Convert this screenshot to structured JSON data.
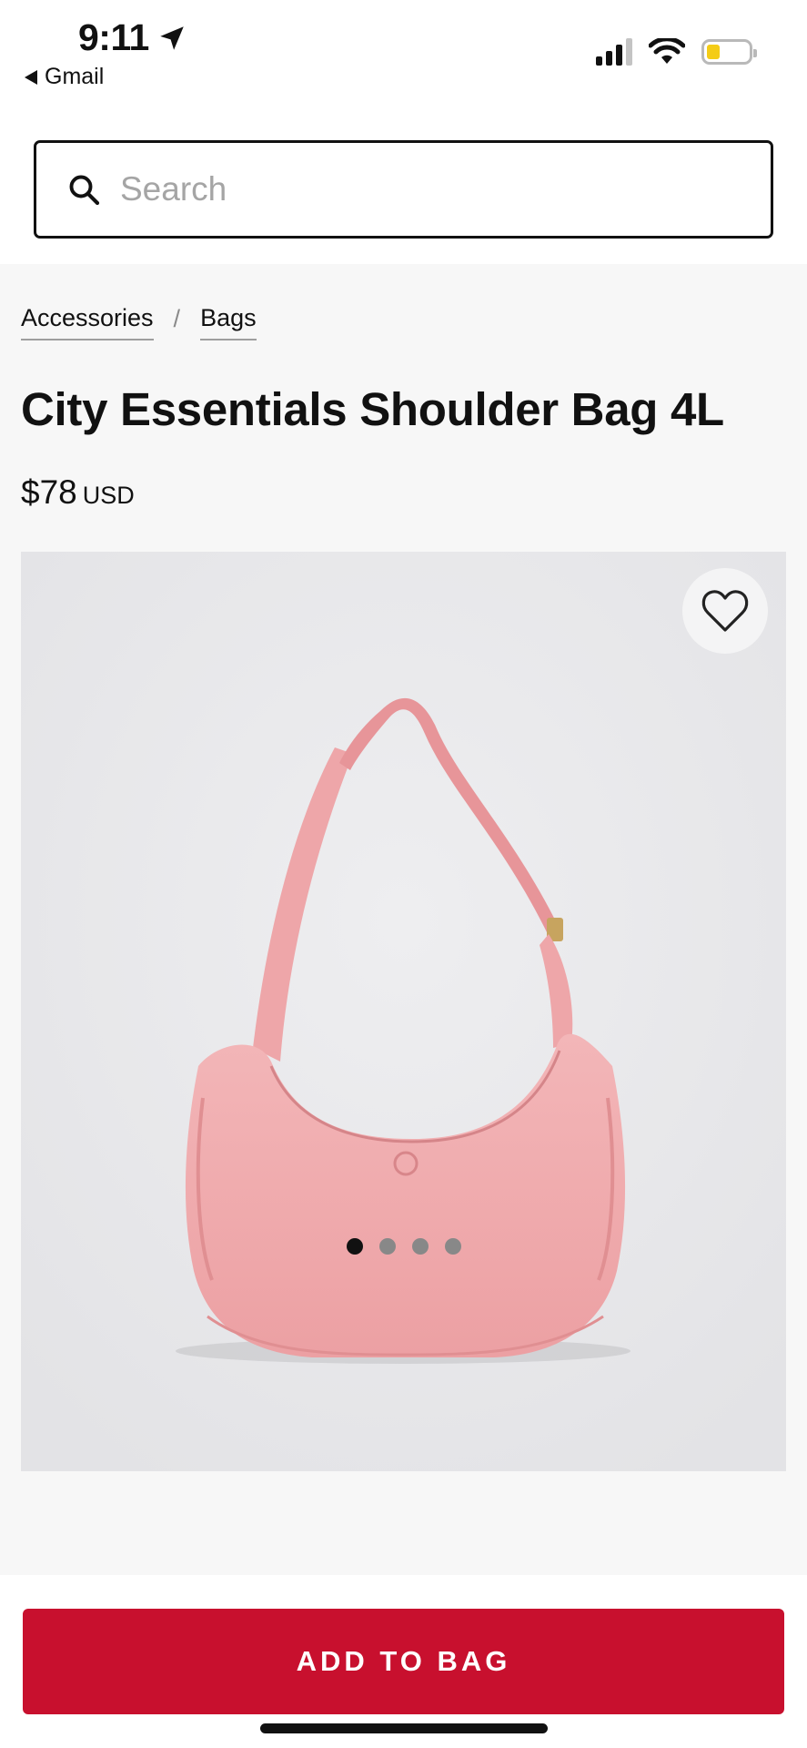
{
  "status_bar": {
    "time": "9:11",
    "back_app": "Gmail"
  },
  "search": {
    "placeholder": "Search"
  },
  "breadcrumb": [
    {
      "label": "Accessories"
    },
    {
      "label": "Bags"
    }
  ],
  "breadcrumb_separator": "/",
  "product": {
    "title": "City Essentials Shoulder Bag 4L",
    "price": "$78",
    "currency": "USD",
    "image_subject": "pink shoulder bag",
    "image_count": 4,
    "active_image_index": 0
  },
  "actions": {
    "add_to_bag": "ADD TO BAG"
  },
  "colors": {
    "accent": "#c8102e",
    "bag": "#f0a9ab",
    "battery": "#f4cc16"
  },
  "icons": {
    "location": "location-arrow-icon",
    "signal": "cellular-signal-icon",
    "wifi": "wifi-icon",
    "battery": "battery-icon",
    "search": "search-icon",
    "wishlist": "heart-icon"
  }
}
